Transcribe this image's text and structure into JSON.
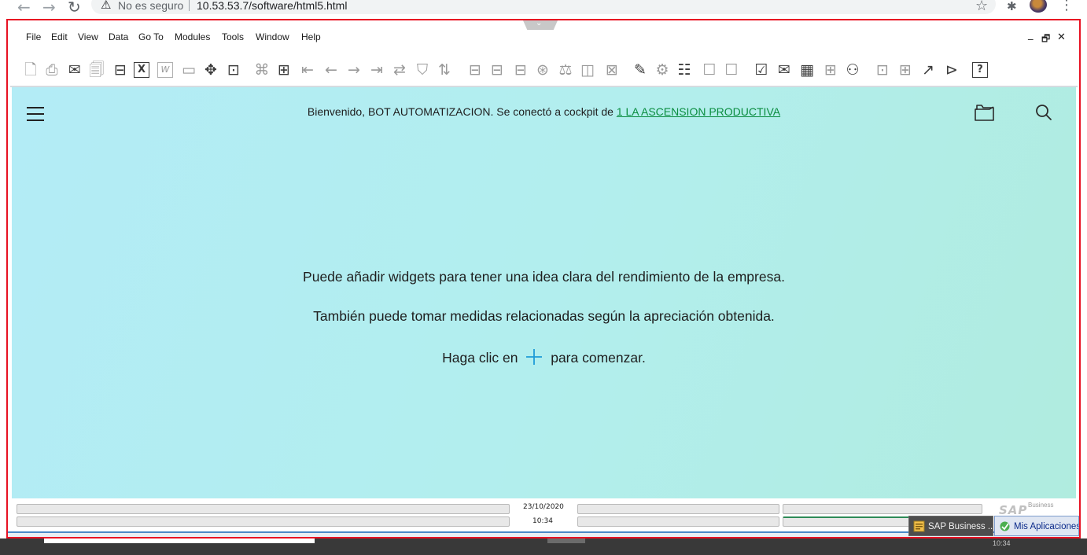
{
  "browser": {
    "back_icon": "←",
    "forward_icon": "→",
    "reload_icon": "↻",
    "security_label": "No es seguro",
    "url": "10.53.53.7/software/html5.html"
  },
  "menu": {
    "items": [
      "File",
      "Edit",
      "View",
      "Data",
      "Go To",
      "Modules",
      "Tools",
      "Window",
      "Help"
    ],
    "minimize_icon": "_",
    "restore_icon": "🗗",
    "close_icon": "✕"
  },
  "toolbar": {
    "buttons": [
      {
        "icon": "preview-icon",
        "glyph": "🗋",
        "enabled": false
      },
      {
        "icon": "print-icon",
        "glyph": "⎙",
        "enabled": false
      },
      {
        "icon": "email-icon",
        "glyph": "✉",
        "enabled": true
      },
      {
        "icon": "sms-icon",
        "glyph": "🗐",
        "enabled": false
      },
      {
        "icon": "fax-icon",
        "glyph": "⊟",
        "enabled": true
      },
      {
        "icon": "excel-icon",
        "glyph": "X",
        "enabled": true
      },
      {
        "icon": "word-icon",
        "glyph": "W",
        "enabled": false
      },
      {
        "icon": "pdf-icon",
        "glyph": "▭",
        "enabled": false
      },
      {
        "icon": "move-icon",
        "glyph": "✥",
        "enabled": true
      },
      {
        "icon": "lock-screen-icon",
        "glyph": "⊡",
        "enabled": true
      },
      {
        "icon": "find-icon",
        "glyph": "⌘",
        "enabled": false
      },
      {
        "icon": "add-icon",
        "glyph": "⊞",
        "enabled": true
      },
      {
        "icon": "first-record-icon",
        "glyph": "⇤",
        "enabled": false
      },
      {
        "icon": "previous-record-icon",
        "glyph": "←",
        "enabled": false
      },
      {
        "icon": "next-record-icon",
        "glyph": "→",
        "enabled": false
      },
      {
        "icon": "last-record-icon",
        "glyph": "⇥",
        "enabled": false
      },
      {
        "icon": "refresh-icon",
        "glyph": "⇄",
        "enabled": false
      },
      {
        "icon": "filter-icon",
        "glyph": "⛉",
        "enabled": false
      },
      {
        "icon": "sort-icon",
        "glyph": "⇅",
        "enabled": false
      },
      {
        "icon": "base-document-icon",
        "glyph": "⊟",
        "enabled": false
      },
      {
        "icon": "target-document-icon",
        "glyph": "⊟",
        "enabled": false
      },
      {
        "icon": "relation-map-icon",
        "glyph": "⊟",
        "enabled": false
      },
      {
        "icon": "payment-means-icon",
        "glyph": "⊛",
        "enabled": false
      },
      {
        "icon": "exchange-rates-icon",
        "glyph": "⚖",
        "enabled": false
      },
      {
        "icon": "layout-icon",
        "glyph": "◫",
        "enabled": false
      },
      {
        "icon": "document-drafts-icon",
        "glyph": "⊠",
        "enabled": false
      },
      {
        "icon": "form-settings-icon",
        "glyph": "✎",
        "enabled": true
      },
      {
        "icon": "query-manager-icon",
        "glyph": "⚙",
        "enabled": false
      },
      {
        "icon": "query-wizard-icon",
        "glyph": "☷",
        "enabled": true
      },
      {
        "icon": "messages-icon",
        "glyph": "☐",
        "enabled": false
      },
      {
        "icon": "alerts-icon",
        "glyph": "☐",
        "enabled": false
      },
      {
        "icon": "approval-icon",
        "glyph": "☑",
        "enabled": true
      },
      {
        "icon": "inbox-icon",
        "glyph": "✉",
        "enabled": true
      },
      {
        "icon": "calendar-icon",
        "glyph": "▦",
        "enabled": true
      },
      {
        "icon": "org-chart-icon",
        "glyph": "⊞",
        "enabled": false
      },
      {
        "icon": "user-icon",
        "glyph": "⚇",
        "enabled": true
      },
      {
        "icon": "workflow-icon",
        "glyph": "⊡",
        "enabled": false
      },
      {
        "icon": "widgets-icon",
        "glyph": "⊞",
        "enabled": false
      },
      {
        "icon": "launch-app-icon",
        "glyph": "↗",
        "enabled": true
      },
      {
        "icon": "import-icon",
        "glyph": "⊳",
        "enabled": true
      },
      {
        "icon": "help-icon",
        "glyph": "?",
        "enabled": true
      }
    ]
  },
  "cockpit": {
    "welcome_prefix": "Bienvenido, BOT AUTOMATIZACION. Se conectó a cockpit de ",
    "company_link": "1 LA ASCENSION PRODUCTIVA",
    "hint_line1": "Puede añadir widgets para tener una idea clara del rendimiento de la empresa.",
    "hint_line2": "También puede tomar medidas relacionadas según la apreciación obtenida.",
    "hint_line3_prefix": "Haga clic en",
    "hint_line3_suffix": "para comenzar.",
    "accent_color": "#1e9bd7",
    "link_color": "#0a8d3f"
  },
  "statusbar": {
    "date": "23/10/2020",
    "time": "10:34",
    "logo_text": "SAP",
    "logo_subtext": "Business"
  },
  "taskbar": {
    "sap_button": "SAP Business ...",
    "mis_aplicaciones_button": "Mis Aplicaciones",
    "clock": "10:34"
  },
  "colors": {
    "highlight_frame": "#e81123",
    "cockpit_background": "#b2eeee"
  }
}
